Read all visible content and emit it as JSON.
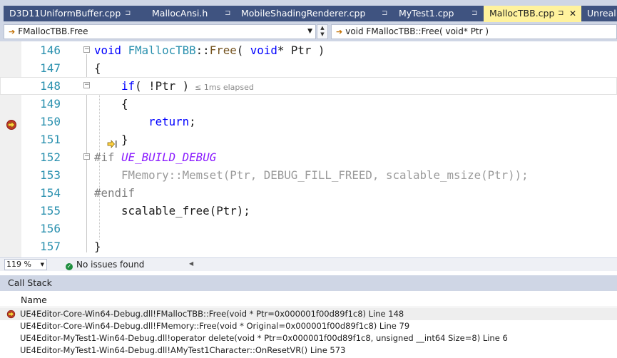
{
  "tabs": [
    {
      "label": "D3D11UniformBuffer.cpp",
      "pin": "⊐"
    },
    {
      "label": "MallocAnsi.h",
      "pin": "⊐"
    },
    {
      "label": "MobileShadingRenderer.cpp",
      "pin": "⊐"
    },
    {
      "label": "MyTest1.cpp",
      "pin": "⊐"
    },
    {
      "label": "MallocTBB.cpp",
      "pin": "⊐",
      "close": "✕",
      "active": true
    },
    {
      "label": "UnrealM"
    }
  ],
  "nav": {
    "scope": "FMallocTBB.Free",
    "member": "void FMallocTBB::Free( void* Ptr )"
  },
  "editor": {
    "lines": [
      146,
      147,
      148,
      149,
      150,
      151,
      152,
      153,
      154,
      155,
      156,
      157
    ],
    "elapsed": "≤ 1ms elapsed",
    "colors": {
      "keyword": "#0000ff",
      "function": "#74531f",
      "type": "#2b91af",
      "macro": "#8a1bff",
      "preprocessor": "#808080",
      "line_number": "#2b91af"
    }
  },
  "status": {
    "zoom": "119 %",
    "issues": "No issues found"
  },
  "callstack": {
    "title": "Call Stack",
    "column": "Name",
    "rows": [
      "UE4Editor-Core-Win64-Debug.dll!FMallocTBB::Free(void * Ptr=0x000001f00d89f1c8) Line 148",
      "UE4Editor-Core-Win64-Debug.dll!FMemory::Free(void * Original=0x000001f00d89f1c8) Line 79",
      "UE4Editor-MyTest1-Win64-Debug.dll!operator delete(void * Ptr=0x000001f00d89f1c8, unsigned __int64 Size=8) Line 6",
      "UE4Editor-MyTest1-Win64-Debug.dll!AMyTest1Character::OnResetVR() Line 573"
    ]
  },
  "icons": {
    "breakpoint": "current-statement-breakpoint-icon",
    "next_statement": "next-statement-arrow-icon",
    "ok": "check-circle-icon"
  }
}
